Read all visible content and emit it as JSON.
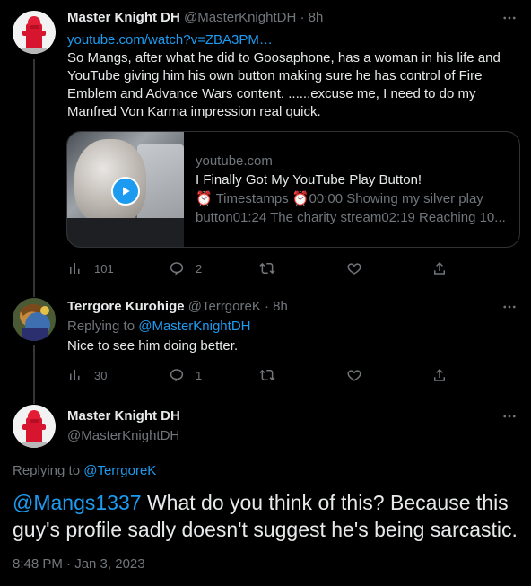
{
  "tweet1": {
    "author_name": "Master Knight DH",
    "author_handle": "@MasterKnightDH",
    "time": "· 8h",
    "link": "youtube.com/watch?v=ZBA3PM…",
    "text": "So Mangs, after what he did to Goosaphone, has a woman in his life and YouTube giving him his own button making sure he has control of Fire Emblem and Advance Wars content. ......excuse me, I need to do my Manfred Von Karma impression real quick.",
    "card": {
      "domain": "youtube.com",
      "title": "I Finally Got My YouTube Play Button!",
      "desc_line1": "⏰ Timestamps ⏰00:00 Showing my silver play",
      "desc_line2": "button01:24 The charity stream02:19 Reaching 10..."
    },
    "stats": {
      "views": "101",
      "replies": "2"
    }
  },
  "tweet2": {
    "author_name": "Terrgore Kurohige",
    "author_handle": "@TerrgoreK",
    "time": "· 8h",
    "replying_prefix": "Replying to",
    "replying_to": "@MasterKnightDH",
    "text": "Nice to see him doing better.",
    "stats": {
      "views": "30",
      "replies": "1"
    }
  },
  "main_tweet": {
    "author_name": "Master Knight DH",
    "author_handle": "@MasterKnightDH",
    "replying_prefix": "Replying to",
    "replying_to": "@TerrgoreK",
    "mention": "@Mangs1337",
    "text": " What do you think of this? Because this guy's profile sadly doesn't suggest he's being sarcastic.",
    "timestamp": "8:48 PM · Jan 3, 2023"
  },
  "icons": {
    "views": "bar-chart-icon",
    "reply": "reply-icon",
    "retweet": "retweet-icon",
    "like": "heart-icon",
    "share": "share-icon",
    "more": "more-icon",
    "play": "play-icon"
  },
  "colors": {
    "background": "#000000",
    "text": "#e7e9ea",
    "muted": "#71767b",
    "accent": "#1d9bf0",
    "border": "#2f3336"
  }
}
